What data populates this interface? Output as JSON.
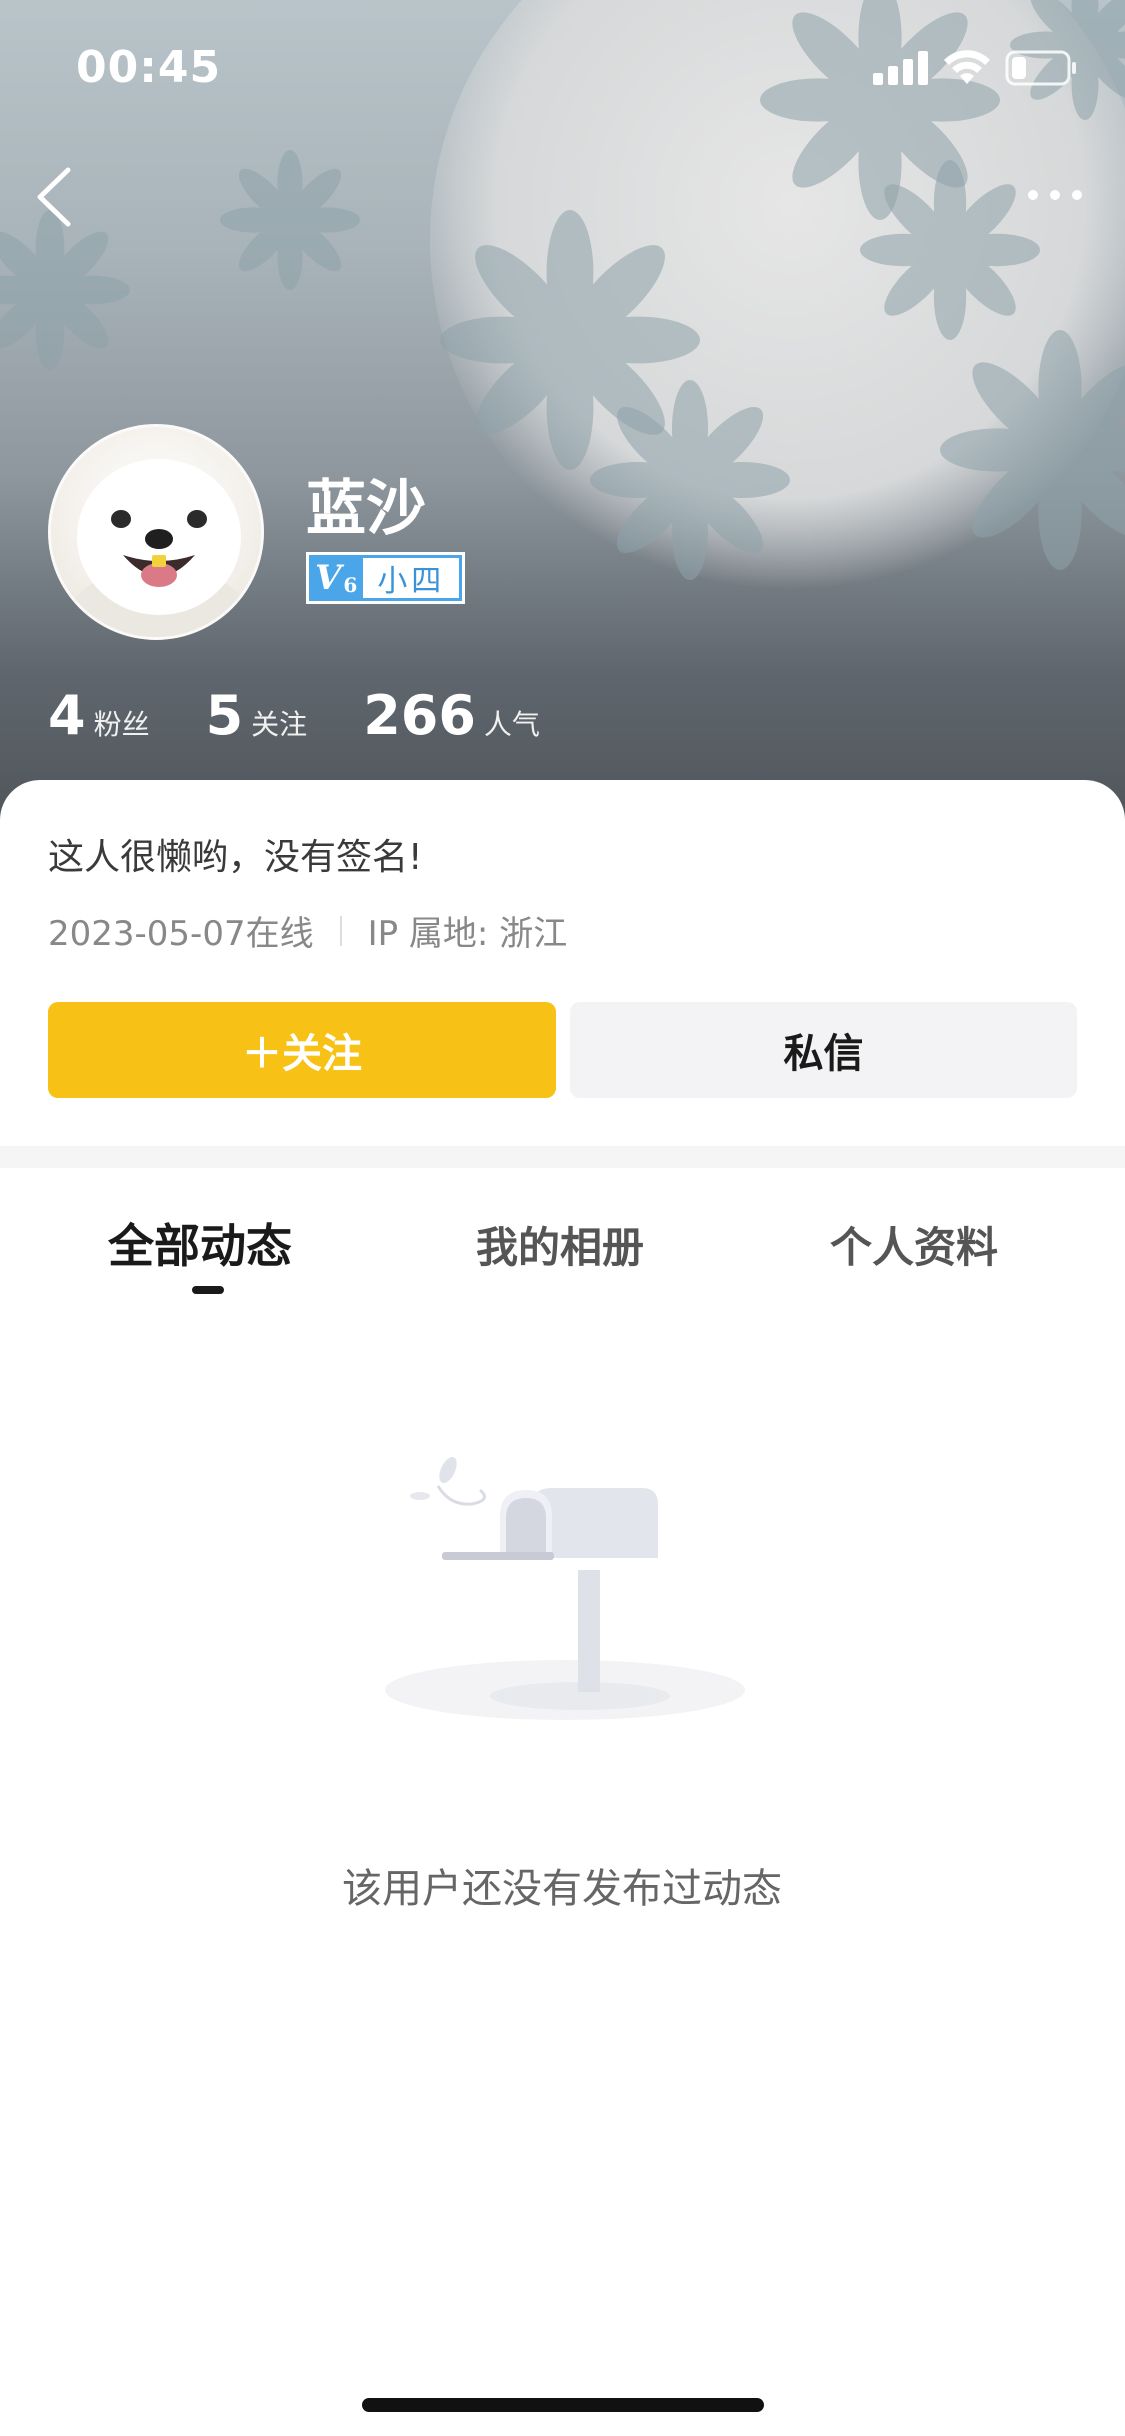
{
  "status_bar": {
    "time": "00:45"
  },
  "profile": {
    "username": "蓝沙",
    "level_prefix": "V",
    "level_number": "6",
    "level_name": "小四",
    "stats": [
      {
        "value": "4",
        "label": "粉丝"
      },
      {
        "value": "5",
        "label": "关注"
      },
      {
        "value": "266",
        "label": "人气"
      }
    ],
    "bio": "这人很懒哟，没有签名!",
    "last_online": "2023-05-07在线",
    "ip_location": "IP 属地: 浙江"
  },
  "actions": {
    "follow": "＋关注",
    "message": "私信"
  },
  "tabs": [
    "全部动态",
    "我的相册",
    "个人资料"
  ],
  "active_tab": 0,
  "empty_state": {
    "text": "该用户还没有发布过动态"
  },
  "colors": {
    "accent": "#f8c116",
    "level_badge": "#4aa6e8"
  }
}
